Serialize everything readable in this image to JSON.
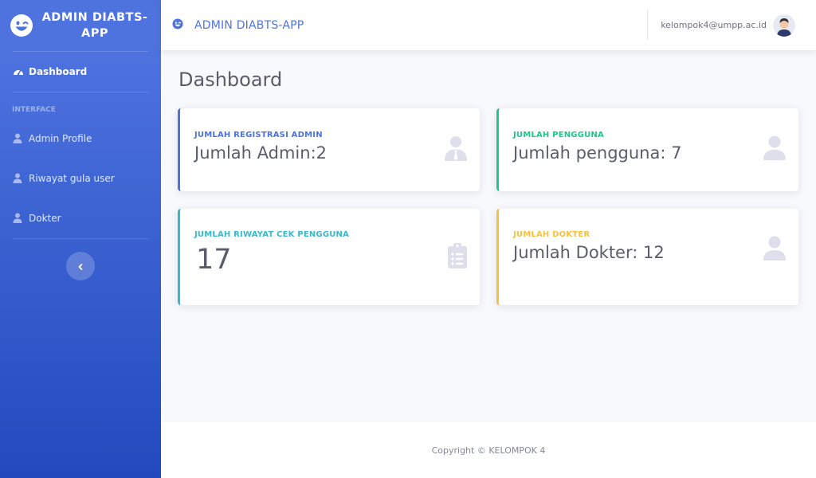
{
  "brand": {
    "name": "ADMIN DIABTS-APP",
    "icon": "laugh-wink-icon"
  },
  "sidebar": {
    "dashboard": {
      "label": "Dashboard",
      "icon": "tachometer-icon"
    },
    "heading": "INTERFACE",
    "items": [
      {
        "label": "Admin Profile",
        "icon": "user-icon"
      },
      {
        "label": "Riwayat gula user",
        "icon": "user-icon"
      },
      {
        "label": "Dokter",
        "icon": "user-icon"
      }
    ],
    "toggle_icon": "chevron-left-icon"
  },
  "topbar": {
    "title": "ADMIN DIABTS-APP",
    "icon": "laugh-wink-icon",
    "user_email": "kelompok4@umpp.ac.id"
  },
  "main": {
    "page_title": "Dashboard",
    "cards": [
      {
        "label": "JUMLAH REGISTRASI ADMIN",
        "value": "Jumlah Admin:2",
        "icon": "user-tie-icon",
        "color": "#4e73df"
      },
      {
        "label": "JUMLAH PENGGUNA",
        "value": "Jumlah pengguna: 7",
        "icon": "user-icon",
        "color": "#1cc88a"
      },
      {
        "label": "JUMLAH RIWAYAT CEK PENGGUNA",
        "value": "17",
        "icon": "clipboard-list-icon",
        "color": "#36b9cc"
      },
      {
        "label": "JUMLAH DOKTER",
        "value": "Jumlah Dokter: 12",
        "icon": "user-icon",
        "color": "#f6c23e"
      }
    ]
  },
  "footer": {
    "copyright": "Copyright © KELOMPOK 4"
  }
}
